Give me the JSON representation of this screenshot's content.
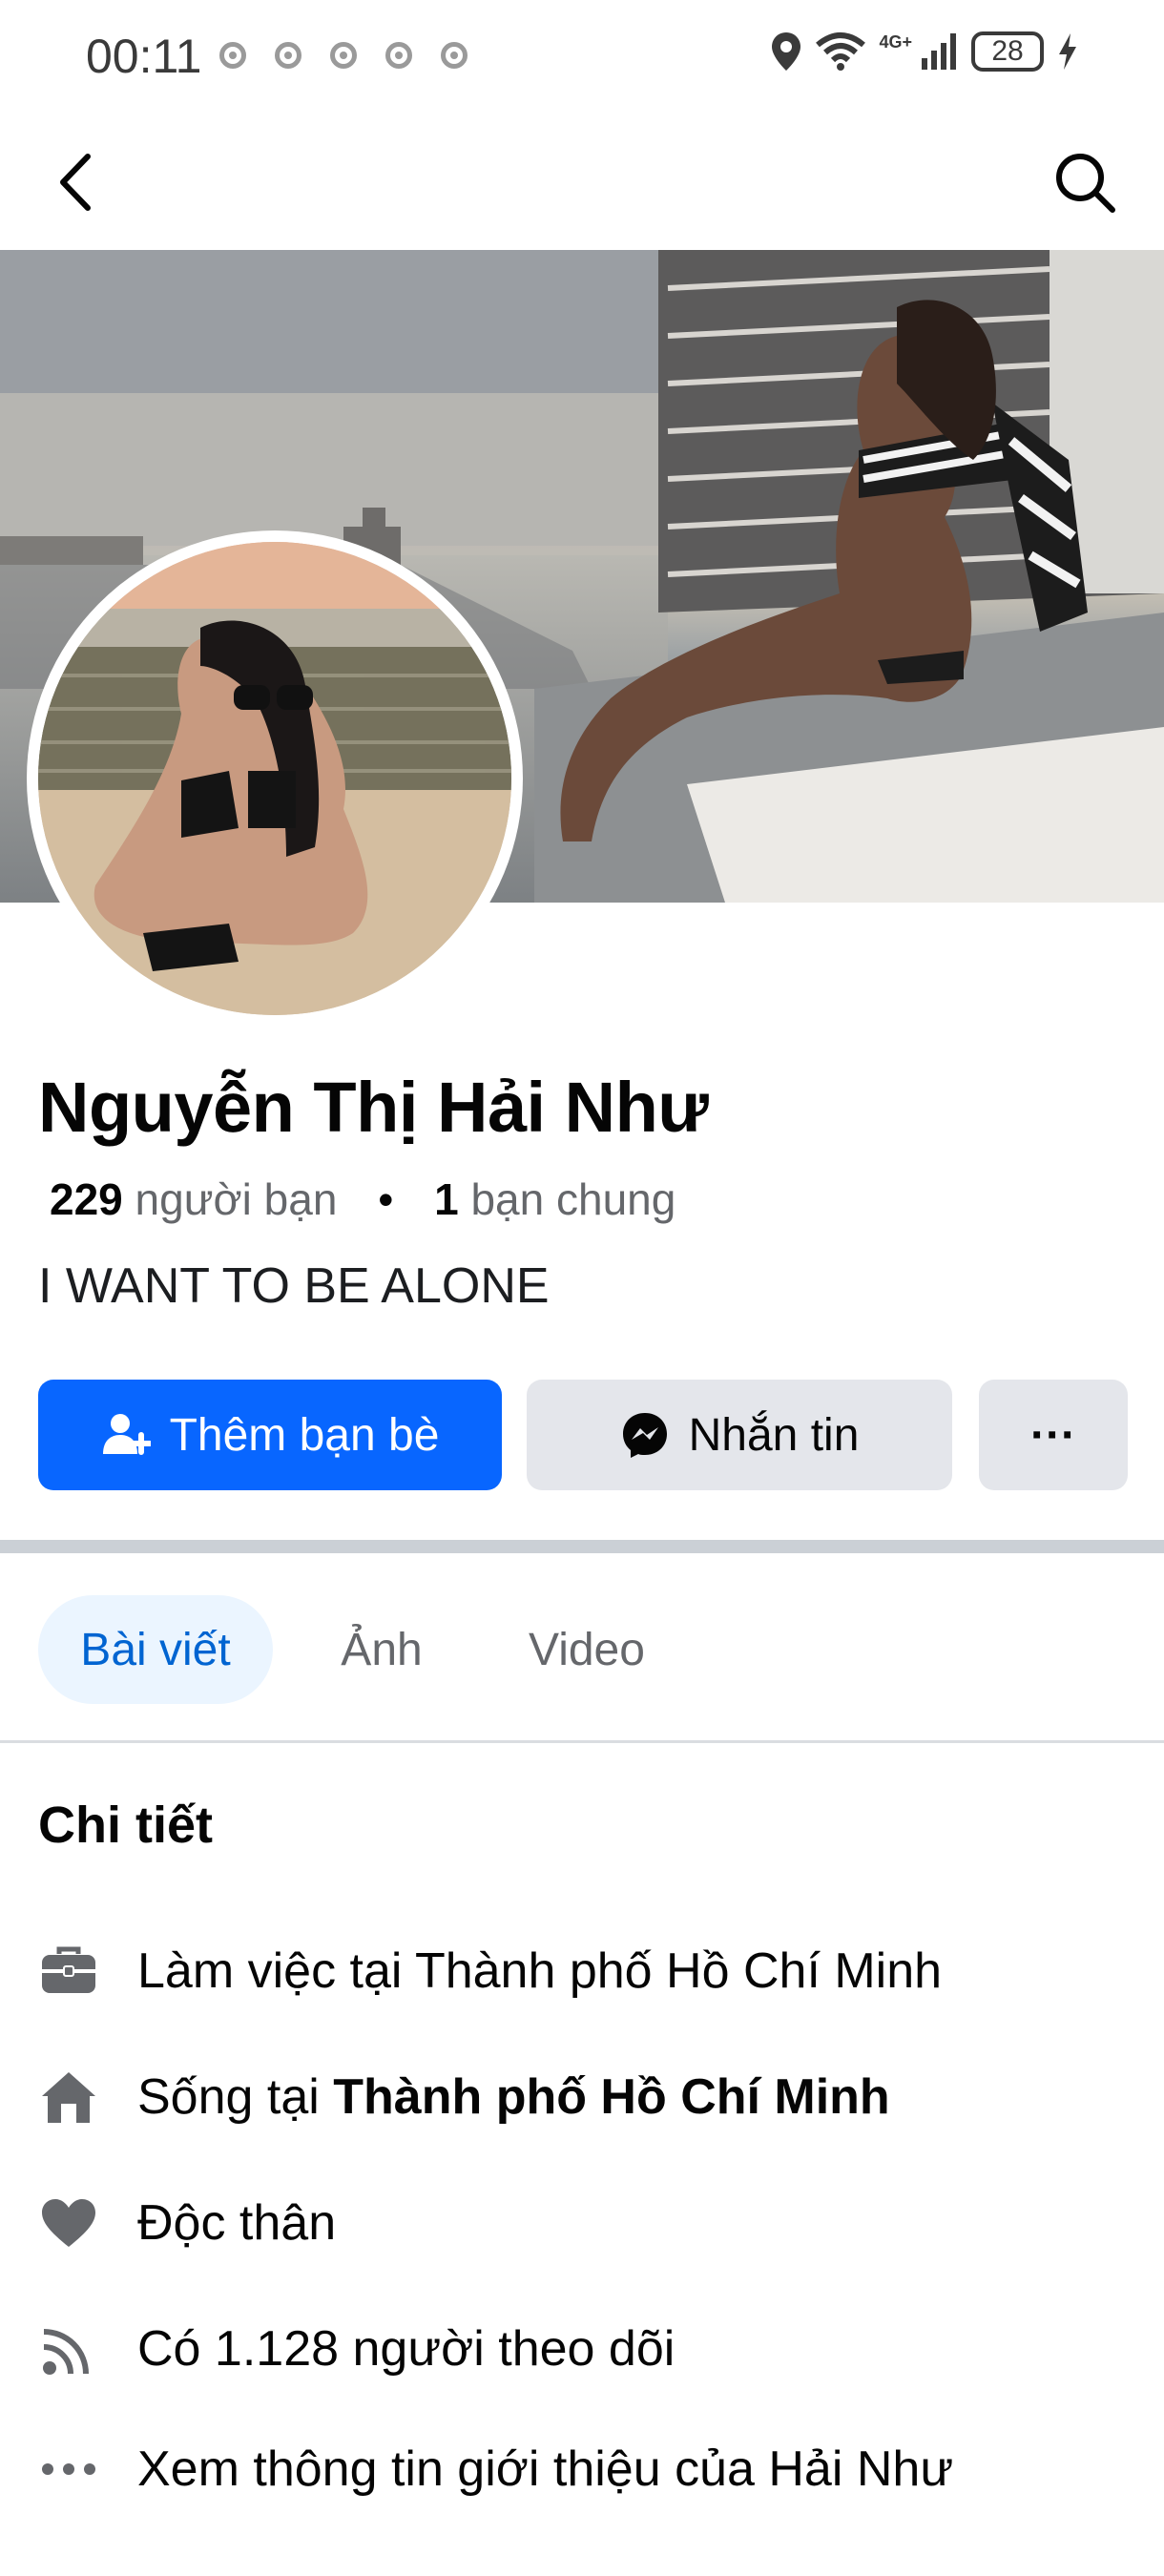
{
  "status_bar": {
    "time": "00:11",
    "network": "4G+",
    "battery": "28"
  },
  "nav": {
    "back_icon": "chevron-left-icon",
    "search_icon": "search-icon"
  },
  "profile": {
    "name": "Nguyễn Thị Hải Như",
    "friends_count": "229",
    "friends_label": "người bạn",
    "separator": "•",
    "mutual_count": "1",
    "mutual_label": "bạn chung",
    "bio": "I WANT TO BE ALONE"
  },
  "actions": {
    "add_friend": "Thêm bạn bè",
    "message": "Nhắn tin",
    "more": "···"
  },
  "tabs": [
    {
      "label": "Bài viết",
      "active": true
    },
    {
      "label": "Ảnh",
      "active": false
    },
    {
      "label": "Video",
      "active": false
    }
  ],
  "details": {
    "title": "Chi tiết",
    "work": "Làm việc tại Thành phố Hồ Chí Minh",
    "lives_prefix": "Sống tại ",
    "lives_city": "Thành phố Hồ Chí Minh",
    "relationship": "Độc thân",
    "followers": "Có 1.128 người theo dõi",
    "see_about": "Xem thông tin giới thiệu của Hải Như"
  },
  "colors": {
    "primary": "#0866ff",
    "secondary_button": "#e4e6eb",
    "active_tab_bg": "#ebf5ff",
    "active_tab_text": "#0064d1",
    "muted_text": "#65676b"
  }
}
